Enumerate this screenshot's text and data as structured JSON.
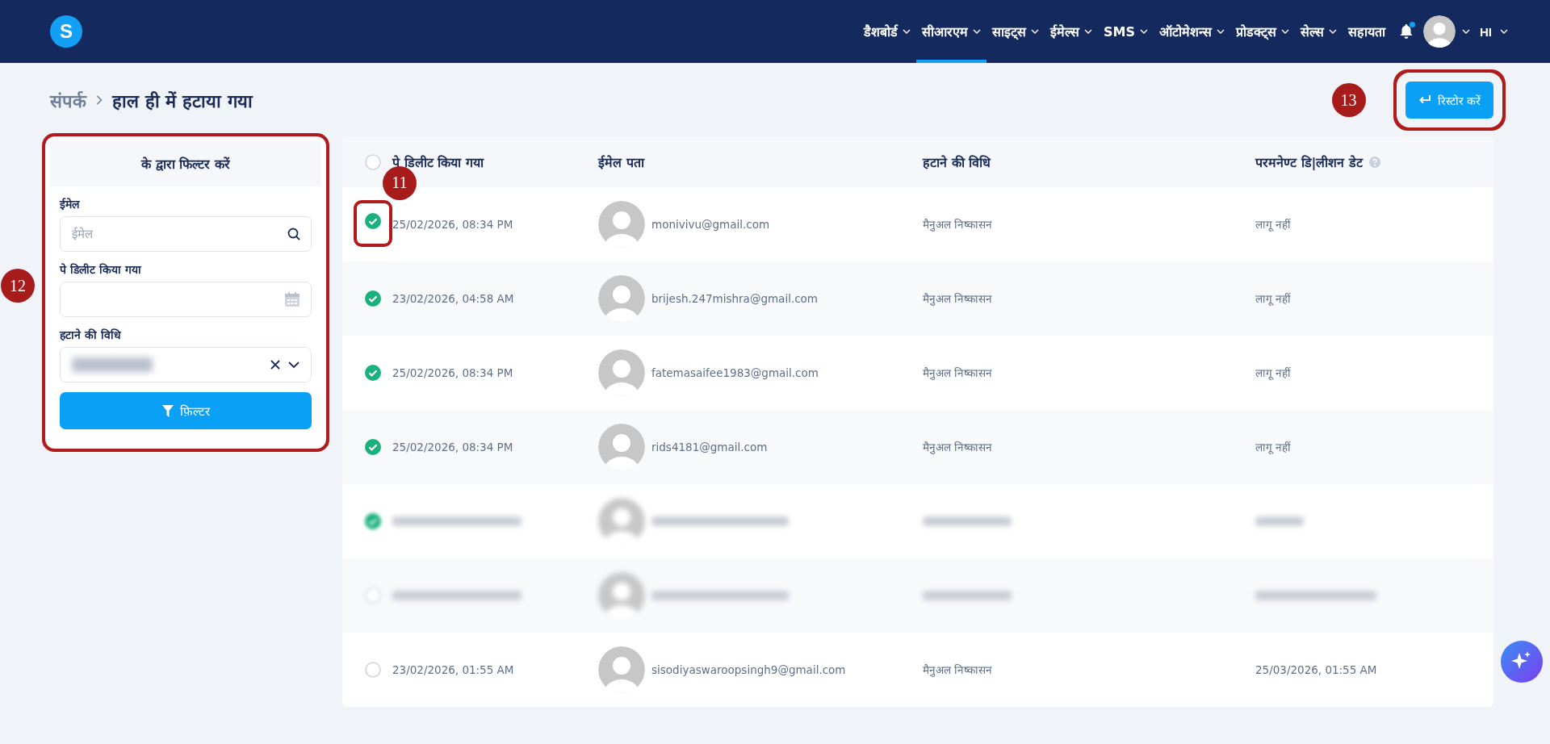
{
  "header": {
    "logo": "S",
    "nav": [
      {
        "label": "डैशबोर्ड",
        "caret": true,
        "selected": false
      },
      {
        "label": "सीआरएम",
        "caret": true,
        "selected": true
      },
      {
        "label": "साइट्स",
        "caret": true,
        "selected": false
      },
      {
        "label": "ईमेल्स",
        "caret": true,
        "selected": false
      },
      {
        "label": "SMS",
        "caret": true,
        "selected": false
      },
      {
        "label": "ऑटोमेशन्स",
        "caret": true,
        "selected": false
      },
      {
        "label": "प्रोडक्ट्स",
        "caret": true,
        "selected": false
      },
      {
        "label": "सेल्स",
        "caret": true,
        "selected": false
      },
      {
        "label": "सहायता",
        "caret": false,
        "selected": false
      }
    ],
    "notifications": {
      "unread": true
    },
    "profile": {
      "caret": true
    },
    "language": {
      "label": "HI",
      "caret": true
    }
  },
  "breadcrumb": {
    "parent": "संपर्क",
    "current": "हाल ही में हटाया गया"
  },
  "restore_button": {
    "label": "रिस्टोर करें",
    "callout": "13"
  },
  "filter_panel": {
    "title": "के द्वारा फिल्टर करें",
    "callout": "12",
    "fields": [
      {
        "kind": "search",
        "label": "ईमेल",
        "placeholder": "ईमेल"
      },
      {
        "kind": "date",
        "label": "पे डिलीट किया गया"
      },
      {
        "kind": "select",
        "label": "हटाने की विधि"
      }
    ],
    "button": "फ़िल्टर"
  },
  "table": {
    "select_all": false,
    "columns": [
      {
        "label": "पे डिलीट किया गया",
        "info": false
      },
      {
        "label": "ईमेल पता",
        "info": false
      },
      {
        "label": "हटाने की विधि",
        "info": false
      },
      {
        "label": "परमनेण्ट डि|लीशन डेट",
        "info": true
      }
    ],
    "rows": [
      {
        "kind": "plain",
        "checked": true,
        "deleted_on": "25/02/2026, 08:34 PM",
        "email": "monivivu@gmail.com",
        "method": "मैनुअल निष्कासन",
        "permanent": "लागू नहीं",
        "callout": "11"
      },
      {
        "kind": "plain",
        "checked": true,
        "deleted_on": "23/02/2026, 04:58 AM",
        "email": "brijesh.247mishra@gmail.com",
        "method": "मैनुअल निष्कासन",
        "permanent": "लागू नहीं"
      },
      {
        "kind": "plain",
        "checked": true,
        "deleted_on": "25/02/2026, 08:34 PM",
        "email": "fatemasaifee1983@gmail.com",
        "method": "मैनुअल निष्कासन",
        "permanent": "लागू नहीं"
      },
      {
        "kind": "plain",
        "checked": true,
        "deleted_on": "25/02/2026, 08:34 PM",
        "email": "rids4181@gmail.com",
        "method": "मैनुअल निष्कासन",
        "permanent": "लागू नहीं"
      },
      {
        "kind": "blurred",
        "checked": true
      },
      {
        "kind": "blurred",
        "checked": false
      },
      {
        "kind": "plain",
        "checked": false,
        "deleted_on": "23/02/2026, 01:55 AM",
        "email": "sisodiyaswaroopsingh9@gmail.com",
        "method": "मैनुअल निष्कासन",
        "permanent": "25/03/2026, 01:55 AM"
      }
    ]
  }
}
